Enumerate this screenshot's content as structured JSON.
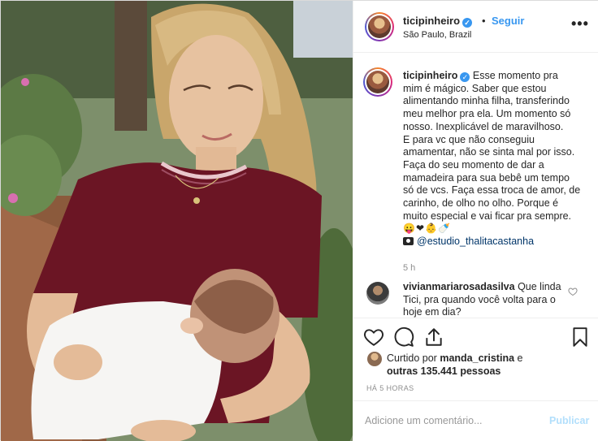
{
  "post": {
    "image_alt": "",
    "header": {
      "username": "ticipinheiro",
      "dot": "•",
      "follow_label": "Seguir",
      "location": "São Paulo, Brazil",
      "more_label": "•••"
    },
    "caption": {
      "username": "ticipinheiro",
      "lines": [
        "Esse momento pra",
        "mim é mágico. Saber que estou",
        "alimentando minha filha, transferindo",
        "meu melhor pra ela. Um momento só",
        "nosso. Inexplicável de maravilhoso.",
        "E para vc que não conseguiu",
        "amamentar, não se sinta mal por isso.",
        "Faça do seu momento de dar a",
        "mamadeira para sua bebê um tempo",
        "só de vcs. Faça essa troca de amor, de",
        "carinho, de olho no olho. Porque é",
        "muito especial e vai ficar pra sempre."
      ],
      "emojis": "😛❤👶🍼",
      "credit_mention": "@estudio_thalitacastanha",
      "time": "5 h"
    },
    "comments": [
      {
        "username": "vivianmariarosadasilva",
        "text": "Que linda Tici, pra quando você volta para o hoje em dia?"
      }
    ],
    "likes": {
      "prefix": "Curtido por",
      "liked_by": "manda_cristina",
      "connector": "e",
      "others": "outras 135.441 pessoas"
    },
    "timestamp": "HÁ 5 HORAS",
    "add_comment": {
      "placeholder": "Adicione um comentário...",
      "publish_label": "Publicar"
    }
  },
  "colors": {
    "accent_blue": "#3897f0",
    "publish_disabled": "#b2dffc",
    "secondary_text": "#8e8e8e",
    "border": "#efefef",
    "shirt": "#6b1524"
  },
  "icons": [
    "verified-badge-icon",
    "more-options-icon",
    "heart-icon",
    "comment-icon",
    "share-icon",
    "bookmark-icon",
    "camera-icon"
  ]
}
